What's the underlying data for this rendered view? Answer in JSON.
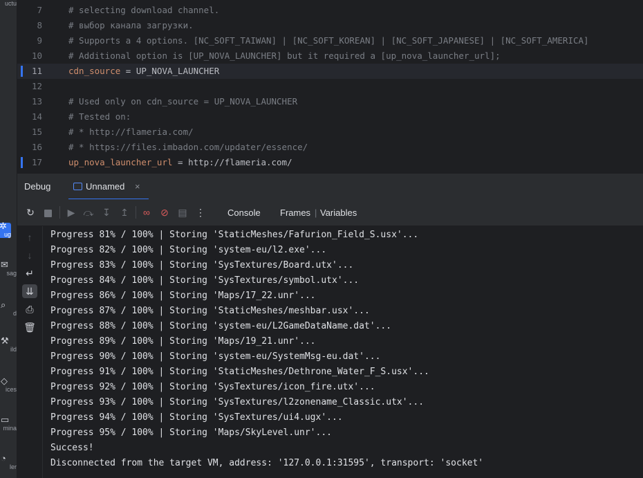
{
  "sidebar": {
    "items": [
      {
        "label": "uctu",
        "icon": "structure-icon"
      },
      {
        "label": "ug",
        "icon": "debug-icon",
        "active": true
      },
      {
        "label": "sag",
        "icon": "messages-icon"
      },
      {
        "label": "d",
        "icon": "find-icon"
      },
      {
        "label": "ild",
        "icon": "build-icon"
      },
      {
        "label": "ices",
        "icon": "services-icon"
      },
      {
        "label": "mina",
        "icon": "terminal-icon"
      },
      {
        "label": "ler",
        "icon": "profiler-icon"
      }
    ]
  },
  "editor": {
    "lines": [
      {
        "num": "7",
        "parts": [
          {
            "t": "comment",
            "text": "# selecting download channel."
          }
        ]
      },
      {
        "num": "8",
        "parts": [
          {
            "t": "comment",
            "text": "# выбор канала загрузки."
          }
        ]
      },
      {
        "num": "9",
        "parts": [
          {
            "t": "comment",
            "text": "# Supports a 4 options. [NC_SOFT_TAIWAN] | [NC_SOFT_KOREAN] | [NC_SOFT_JAPANESE] | [NC_SOFT_AMERICA]"
          }
        ]
      },
      {
        "num": "10",
        "parts": [
          {
            "t": "comment",
            "text": "# Additional option is [UP_NOVA_LAUNCHER] but it required a [up_nova_launcher_url];"
          }
        ]
      },
      {
        "num": "11",
        "caret": true,
        "changed": true,
        "parts": [
          {
            "t": "key",
            "text": "cdn_source"
          },
          {
            "t": "val",
            "text": " = UP_NOVA_LAUNCHER"
          }
        ]
      },
      {
        "num": "12",
        "parts": []
      },
      {
        "num": "13",
        "parts": [
          {
            "t": "comment",
            "text": "# Used only on cdn_source = UP_NOVA_LAUNCHER"
          }
        ]
      },
      {
        "num": "14",
        "parts": [
          {
            "t": "comment",
            "text": "# Tested on:"
          }
        ]
      },
      {
        "num": "15",
        "parts": [
          {
            "t": "comment",
            "text": "# * http://flameria.com/"
          }
        ]
      },
      {
        "num": "16",
        "parts": [
          {
            "t": "comment",
            "text": "# * https://files.imbadon.com/updater/essence/"
          }
        ]
      },
      {
        "num": "17",
        "changed": true,
        "parts": [
          {
            "t": "key",
            "text": "up_nova_launcher_url"
          },
          {
            "t": "val",
            "text": " = http://flameria.com/"
          }
        ]
      }
    ]
  },
  "debug": {
    "title": "Debug",
    "tab_label": "Unnamed",
    "tab_close": "×",
    "toolbar": {
      "icons": [
        "rerun-icon",
        "stop-icon",
        "resume-icon",
        "step-over-icon",
        "step-into-icon",
        "step-out-icon",
        "view-breakpoints-icon",
        "mute-breakpoints-icon",
        "frames-layout-icon",
        "more-icon"
      ],
      "console_label": "Console",
      "frames_label": "Frames",
      "variables_label": "Variables"
    },
    "side_tools": [
      "up-arrow-icon",
      "down-arrow-icon",
      "soft-wrap-icon",
      "scroll-to-end-icon",
      "print-icon",
      "clear-all-icon"
    ]
  },
  "console": {
    "lines": [
      "Progress 81% / 100% | Storing 'StaticMeshes/Fafurion_Field_S.usx'...",
      "Progress 82% / 100% | Storing 'system-eu/l2.exe'...",
      "Progress 83% / 100% | Storing 'SysTextures/Board.utx'...",
      "Progress 84% / 100% | Storing 'SysTextures/symbol.utx'...",
      "Progress 86% / 100% | Storing 'Maps/17_22.unr'...",
      "Progress 87% / 100% | Storing 'StaticMeshes/meshbar.usx'...",
      "Progress 88% / 100% | Storing 'system-eu/L2GameDataName.dat'...",
      "Progress 89% / 100% | Storing 'Maps/19_21.unr'...",
      "Progress 90% / 100% | Storing 'system-eu/SystemMsg-eu.dat'...",
      "Progress 91% / 100% | Storing 'StaticMeshes/Dethrone_Water_F_S.usx'...",
      "Progress 92% / 100% | Storing 'SysTextures/icon_fire.utx'...",
      "Progress 93% / 100% | Storing 'SysTextures/l2zonename_Classic.utx'...",
      "Progress 94% / 100% | Storing 'SysTextures/ui4.ugx'...",
      "Progress 95% / 100% | Storing 'Maps/SkyLevel.unr'...",
      "Success!",
      "Disconnected from the target VM, address: '127.0.0.1:31595', transport: 'socket'"
    ]
  },
  "colors": {
    "accent": "#3574f0",
    "comment": "#7a7e85",
    "key": "#cf8e6d",
    "text": "#bcbec4",
    "background": "#1e1f22",
    "panel": "#2b2d30"
  }
}
